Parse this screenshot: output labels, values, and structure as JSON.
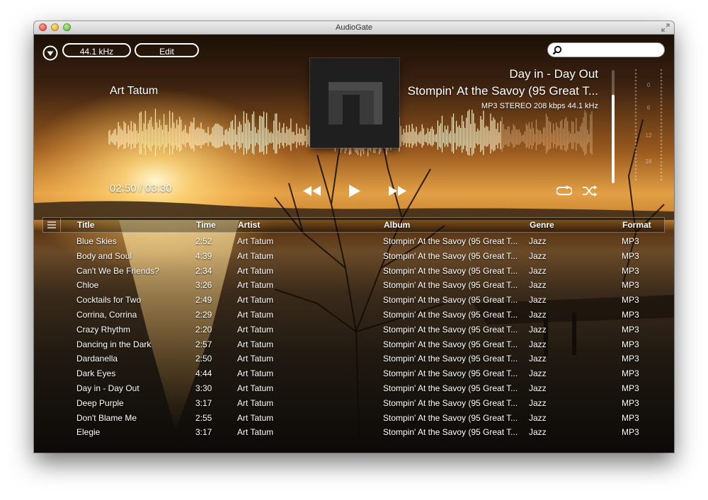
{
  "window": {
    "title": "AudioGate"
  },
  "toolbar": {
    "sample_rate_label": "44.1 kHz",
    "edit_label": "Edit",
    "search_placeholder": ""
  },
  "now_playing": {
    "artist": "Art Tatum",
    "title": "Day in - Day Out",
    "album": "Stompin' At the Savoy (95 Great T...",
    "format_info": "MP3 STEREO 208 kbps 44.1 kHz",
    "time": "02:50 / 03:30",
    "progress": 0.81,
    "volume": 0.78
  },
  "table": {
    "columns": [
      "Title",
      "Time",
      "Artist",
      "Album",
      "Genre",
      "Format"
    ],
    "rows": [
      {
        "title": "Blue Skies",
        "time": "2:52",
        "artist": "Art Tatum",
        "album": "Stompin' At the Savoy (95 Great T...",
        "genre": "Jazz",
        "format": "MP3"
      },
      {
        "title": "Body and Soul",
        "time": "4:39",
        "artist": "Art Tatum",
        "album": "Stompin' At the Savoy (95 Great T...",
        "genre": "Jazz",
        "format": "MP3"
      },
      {
        "title": "Can't We Be Friends?",
        "time": "2:34",
        "artist": "Art Tatum",
        "album": "Stompin' At the Savoy (95 Great T...",
        "genre": "Jazz",
        "format": "MP3"
      },
      {
        "title": "Chloe",
        "time": "3:26",
        "artist": "Art Tatum",
        "album": "Stompin' At the Savoy (95 Great T...",
        "genre": "Jazz",
        "format": "MP3"
      },
      {
        "title": "Cocktails for Two",
        "time": "2:49",
        "artist": "Art Tatum",
        "album": "Stompin' At the Savoy (95 Great T...",
        "genre": "Jazz",
        "format": "MP3"
      },
      {
        "title": "Corrina, Corrina",
        "time": "2:29",
        "artist": "Art Tatum",
        "album": "Stompin' At the Savoy (95 Great T...",
        "genre": "Jazz",
        "format": "MP3"
      },
      {
        "title": "Crazy Rhythm",
        "time": "2:20",
        "artist": "Art Tatum",
        "album": "Stompin' At the Savoy (95 Great T...",
        "genre": "Jazz",
        "format": "MP3"
      },
      {
        "title": "Dancing in the Dark",
        "time": "2:57",
        "artist": "Art Tatum",
        "album": "Stompin' At the Savoy (95 Great T...",
        "genre": "Jazz",
        "format": "MP3"
      },
      {
        "title": "Dardanella",
        "time": "2:50",
        "artist": "Art Tatum",
        "album": "Stompin' At the Savoy (95 Great T...",
        "genre": "Jazz",
        "format": "MP3"
      },
      {
        "title": "Dark Eyes",
        "time": "4:44",
        "artist": "Art Tatum",
        "album": "Stompin' At the Savoy (95 Great T...",
        "genre": "Jazz",
        "format": "MP3"
      },
      {
        "title": "Day in - Day Out",
        "time": "3:30",
        "artist": "Art Tatum",
        "album": "Stompin' At the Savoy (95 Great T...",
        "genre": "Jazz",
        "format": "MP3"
      },
      {
        "title": "Deep Purple",
        "time": "3:17",
        "artist": "Art Tatum",
        "album": "Stompin' At the Savoy (95 Great T...",
        "genre": "Jazz",
        "format": "MP3"
      },
      {
        "title": "Don't Blame Me",
        "time": "2:55",
        "artist": "Art Tatum",
        "album": "Stompin' At the Savoy (95 Great T...",
        "genre": "Jazz",
        "format": "MP3"
      },
      {
        "title": "Elegie",
        "time": "3:17",
        "artist": "Art Tatum",
        "album": "Stompin' At the Savoy (95 Great T...",
        "genre": "Jazz",
        "format": "MP3"
      }
    ]
  },
  "meters": {
    "scale": [
      "0",
      "6",
      "12",
      "24"
    ]
  },
  "icons": {
    "menu": "down-triangle-circle-icon",
    "search": "magnifier-icon",
    "rewind": "rewind-icon",
    "play": "play-icon",
    "forward": "fast-forward-icon",
    "repeat": "repeat-icon",
    "shuffle": "shuffle-icon",
    "list": "list-icon",
    "fullscreen": "fullscreen-icon"
  },
  "colors": {
    "accent": "#ffffff",
    "sky_top": "#2a1608",
    "sun": "#ffd77a"
  }
}
